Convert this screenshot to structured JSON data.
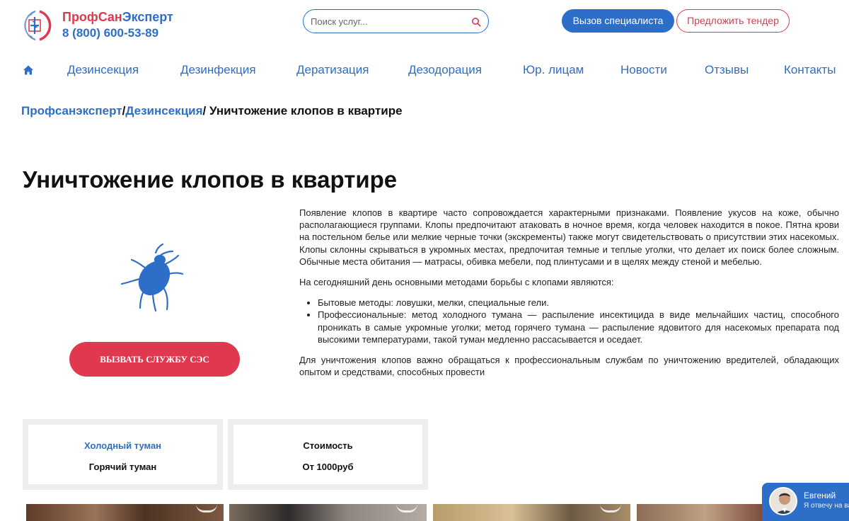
{
  "header": {
    "brand_part1": "Проф",
    "brand_part2": "Сан",
    "brand_part3": "Эксперт",
    "phone": "8 (800) 600-53-89",
    "search_placeholder": "Поиск услуг...",
    "call_button": "Вызов специалиста",
    "tender_button": "Предложить тендер"
  },
  "nav": {
    "items": [
      "Дезинсекция",
      "Дезинфекция",
      "Дератизация",
      "Дезодорация",
      "Юр. лицам",
      "Новости",
      "Отзывы",
      "Контакты"
    ]
  },
  "breadcrumb": {
    "home": "Профсанэксперт",
    "separator1": "/",
    "section": "Дезинсекция",
    "separator2": "/",
    "current": " Уничтожение клопов в квартире"
  },
  "page": {
    "title": "Уничтожение клопов в квартире",
    "ses_button": "ВЫЗВАТЬ СЛУЖБУ СЭС"
  },
  "article": {
    "p1": "Появление клопов в квартире часто сопровождается характерными признаками. Появление укусов на коже, обычно располагающиеся группами. Клопы предпочитают атаковать в ночное время, когда человек находится в покое. Пятна крови на постельном белье или мелкие черные точки (экскременты) также могут свидетельствовать о присутствии этих насекомых. Клопы склонны скрываться в укромных местах, предпочитая темные и теплые уголки, что делает их поиск более сложным. Обычные места обитания — матрасы, обивка мебели, под плинтусами и в щелях между стеной и мебелью.",
    "p2": "На сегодняшний день основными методами борьбы с клопами являются:",
    "list": [
      "Бытовые методы: ловушки, мелки, специальные гели.",
      "Профессиональные: метод холодного тумана — распыление инсектицида в виде мельчайших частиц, способного проникать в самые укромные уголки; метод горячего тумана — распыление ядовитого для насекомых препарата под высокими температурами, такой туман медленно рассасывается и оседает."
    ],
    "p3": "Для уничтожения клопов важно обращаться к профессиональным службам по уничтожению вредителей, обладающих опытом и средствами, способных провести"
  },
  "cards": {
    "methods_line1": "Холодный туман",
    "methods_line2": "Горячий туман",
    "price_label": "Стоимость",
    "price_value": "От 1000руб"
  },
  "chat": {
    "name": "Евгений",
    "status": "Я отвечу на ва"
  },
  "colors": {
    "brand_blue": "#2d6ec9",
    "brand_red": "#e0384f"
  }
}
